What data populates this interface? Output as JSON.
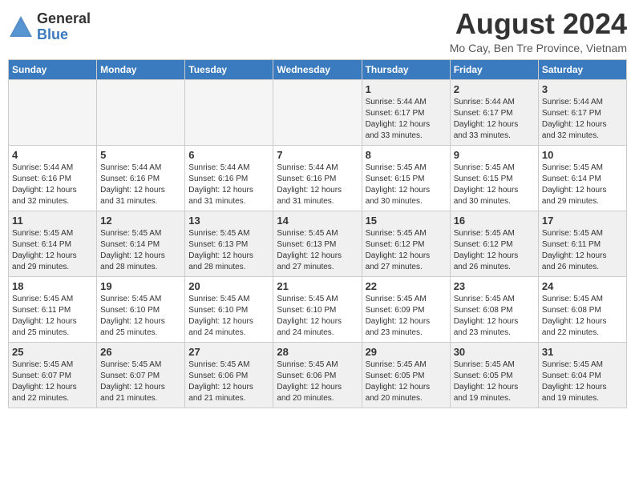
{
  "logo": {
    "general": "General",
    "blue": "Blue"
  },
  "header": {
    "month": "August 2024",
    "location": "Mo Cay, Ben Tre Province, Vietnam"
  },
  "days_of_week": [
    "Sunday",
    "Monday",
    "Tuesday",
    "Wednesday",
    "Thursday",
    "Friday",
    "Saturday"
  ],
  "weeks": [
    [
      {
        "day": "",
        "info": "",
        "empty": true
      },
      {
        "day": "",
        "info": "",
        "empty": true
      },
      {
        "day": "",
        "info": "",
        "empty": true
      },
      {
        "day": "",
        "info": "",
        "empty": true
      },
      {
        "day": "1",
        "info": "Sunrise: 5:44 AM\nSunset: 6:17 PM\nDaylight: 12 hours\nand 33 minutes."
      },
      {
        "day": "2",
        "info": "Sunrise: 5:44 AM\nSunset: 6:17 PM\nDaylight: 12 hours\nand 33 minutes."
      },
      {
        "day": "3",
        "info": "Sunrise: 5:44 AM\nSunset: 6:17 PM\nDaylight: 12 hours\nand 32 minutes."
      }
    ],
    [
      {
        "day": "4",
        "info": "Sunrise: 5:44 AM\nSunset: 6:16 PM\nDaylight: 12 hours\nand 32 minutes."
      },
      {
        "day": "5",
        "info": "Sunrise: 5:44 AM\nSunset: 6:16 PM\nDaylight: 12 hours\nand 31 minutes."
      },
      {
        "day": "6",
        "info": "Sunrise: 5:44 AM\nSunset: 6:16 PM\nDaylight: 12 hours\nand 31 minutes."
      },
      {
        "day": "7",
        "info": "Sunrise: 5:44 AM\nSunset: 6:16 PM\nDaylight: 12 hours\nand 31 minutes."
      },
      {
        "day": "8",
        "info": "Sunrise: 5:45 AM\nSunset: 6:15 PM\nDaylight: 12 hours\nand 30 minutes."
      },
      {
        "day": "9",
        "info": "Sunrise: 5:45 AM\nSunset: 6:15 PM\nDaylight: 12 hours\nand 30 minutes."
      },
      {
        "day": "10",
        "info": "Sunrise: 5:45 AM\nSunset: 6:14 PM\nDaylight: 12 hours\nand 29 minutes."
      }
    ],
    [
      {
        "day": "11",
        "info": "Sunrise: 5:45 AM\nSunset: 6:14 PM\nDaylight: 12 hours\nand 29 minutes."
      },
      {
        "day": "12",
        "info": "Sunrise: 5:45 AM\nSunset: 6:14 PM\nDaylight: 12 hours\nand 28 minutes."
      },
      {
        "day": "13",
        "info": "Sunrise: 5:45 AM\nSunset: 6:13 PM\nDaylight: 12 hours\nand 28 minutes."
      },
      {
        "day": "14",
        "info": "Sunrise: 5:45 AM\nSunset: 6:13 PM\nDaylight: 12 hours\nand 27 minutes."
      },
      {
        "day": "15",
        "info": "Sunrise: 5:45 AM\nSunset: 6:12 PM\nDaylight: 12 hours\nand 27 minutes."
      },
      {
        "day": "16",
        "info": "Sunrise: 5:45 AM\nSunset: 6:12 PM\nDaylight: 12 hours\nand 26 minutes."
      },
      {
        "day": "17",
        "info": "Sunrise: 5:45 AM\nSunset: 6:11 PM\nDaylight: 12 hours\nand 26 minutes."
      }
    ],
    [
      {
        "day": "18",
        "info": "Sunrise: 5:45 AM\nSunset: 6:11 PM\nDaylight: 12 hours\nand 25 minutes."
      },
      {
        "day": "19",
        "info": "Sunrise: 5:45 AM\nSunset: 6:10 PM\nDaylight: 12 hours\nand 25 minutes."
      },
      {
        "day": "20",
        "info": "Sunrise: 5:45 AM\nSunset: 6:10 PM\nDaylight: 12 hours\nand 24 minutes."
      },
      {
        "day": "21",
        "info": "Sunrise: 5:45 AM\nSunset: 6:10 PM\nDaylight: 12 hours\nand 24 minutes."
      },
      {
        "day": "22",
        "info": "Sunrise: 5:45 AM\nSunset: 6:09 PM\nDaylight: 12 hours\nand 23 minutes."
      },
      {
        "day": "23",
        "info": "Sunrise: 5:45 AM\nSunset: 6:08 PM\nDaylight: 12 hours\nand 23 minutes."
      },
      {
        "day": "24",
        "info": "Sunrise: 5:45 AM\nSunset: 6:08 PM\nDaylight: 12 hours\nand 22 minutes."
      }
    ],
    [
      {
        "day": "25",
        "info": "Sunrise: 5:45 AM\nSunset: 6:07 PM\nDaylight: 12 hours\nand 22 minutes."
      },
      {
        "day": "26",
        "info": "Sunrise: 5:45 AM\nSunset: 6:07 PM\nDaylight: 12 hours\nand 21 minutes."
      },
      {
        "day": "27",
        "info": "Sunrise: 5:45 AM\nSunset: 6:06 PM\nDaylight: 12 hours\nand 21 minutes."
      },
      {
        "day": "28",
        "info": "Sunrise: 5:45 AM\nSunset: 6:06 PM\nDaylight: 12 hours\nand 20 minutes."
      },
      {
        "day": "29",
        "info": "Sunrise: 5:45 AM\nSunset: 6:05 PM\nDaylight: 12 hours\nand 20 minutes."
      },
      {
        "day": "30",
        "info": "Sunrise: 5:45 AM\nSunset: 6:05 PM\nDaylight: 12 hours\nand 19 minutes."
      },
      {
        "day": "31",
        "info": "Sunrise: 5:45 AM\nSunset: 6:04 PM\nDaylight: 12 hours\nand 19 minutes."
      }
    ]
  ]
}
